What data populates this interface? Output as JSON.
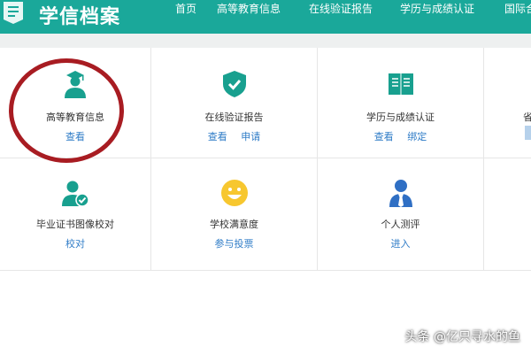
{
  "header": {
    "logo_text": "学信档案",
    "nav": [
      "首页",
      "高等教育信息",
      "在线验证报告",
      "学历与成绩认证",
      "国际合"
    ]
  },
  "tiles": [
    {
      "title": "高等教育信息",
      "actions": [
        "查看"
      ],
      "icon": "graduate-icon"
    },
    {
      "title": "在线验证报告",
      "actions": [
        "查看",
        "申请"
      ],
      "icon": "shield-check-icon"
    },
    {
      "title": "学历与成绩认证",
      "actions": [
        "查看",
        "绑定"
      ],
      "icon": "book-icon"
    },
    {
      "title": "毕业证书图像校对",
      "actions": [
        "校对"
      ],
      "icon": "user-check-icon"
    },
    {
      "title": "学校满意度",
      "actions": [
        "参与投票"
      ],
      "icon": "smiley-icon"
    },
    {
      "title": "个人测评",
      "actions": [
        "进入"
      ],
      "icon": "person-tie-icon"
    }
  ],
  "partial_tile": {
    "title_fragment": "省"
  },
  "watermark": "头条 @亿只寻水的鱼",
  "colors": {
    "header": "#1aa89a",
    "link": "#2f7cc7",
    "annotation_circle": "#a81c22"
  }
}
